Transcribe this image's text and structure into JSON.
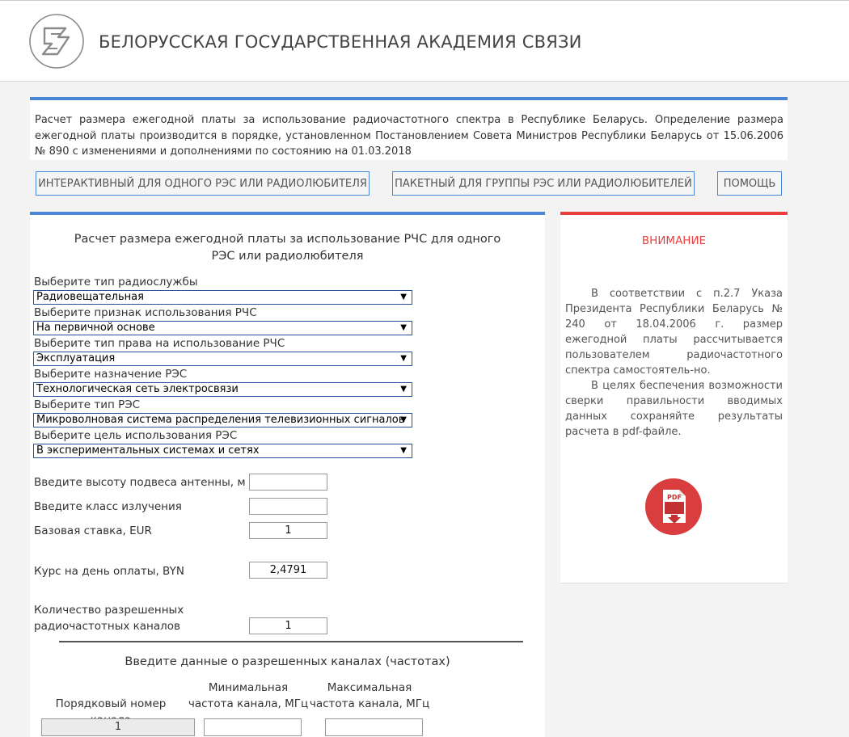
{
  "header": {
    "org_name": "БЕЛОРУССКАЯ ГОСУДАРСТВЕННАЯ АКАДЕМИЯ СВЯЗИ"
  },
  "notice": {
    "text": "Расчет размера ежегодной платы за использование радиочастотного спектра в Республике Беларусь. Определение размера ежегодной платы производится в порядке, установленном Постановлением Совета Министров Республики Беларусь от 15.06.2006 № 890 с изменениями и дополнениями по состоянию на 01.03.2018"
  },
  "tabs": {
    "interactive": "ИНТЕРАКТИВНЫЙ ДЛЯ ОДНОГО РЭС ИЛИ РАДИОЛЮБИТЕЛЯ",
    "batch": "ПАКЕТНЫЙ ДЛЯ ГРУППЫ РЭС ИЛИ РАДИОЛЮБИТЕЛЕЙ",
    "help": "ПОМОЩЬ"
  },
  "main": {
    "title": "Расчет размера ежегодной платы за использование РЧС для одного РЭС или радиолюбителя",
    "selects": [
      {
        "label": "Выберите тип радиослужбы",
        "value": "Радиовещательная"
      },
      {
        "label": "Выберите признак использования РЧС",
        "value": "На первичной основе"
      },
      {
        "label": "Выберите тип права на использование РЧС",
        "value": "Эксплуатация"
      },
      {
        "label": "Выберите назначение РЭС",
        "value": "Технологическая сеть электросвязи"
      },
      {
        "label": "Выберите тип РЭС",
        "value": "Микроволновая система распределения телевизионных сигналов"
      },
      {
        "label": "Выберите цель использования РЭС",
        "value": "В экспериментальных системах и сетях"
      }
    ],
    "antenna_height": {
      "label": "Введите высоту подвеса антенны, м",
      "value": ""
    },
    "emission_class": {
      "label": "Введите класс излучения",
      "value": ""
    },
    "base_rate": {
      "label": "Базовая ставка, EUR",
      "value": "1"
    },
    "exchange_rate": {
      "label": "Курс на день оплаты, BYN",
      "value": "2,4791"
    },
    "channel_count": {
      "label_line1": "Количество разрешенных",
      "label_line2": "радиочастотных каналов",
      "value": "1"
    },
    "channels": {
      "title": "Введите данные о разрешенных каналах (частотах)",
      "col_number": "Порядковый номер канала",
      "col_min_line1": "Минимальная",
      "col_min_line2": "частота канала, МГц",
      "col_max_line1": "Максимальная",
      "col_max_line2": "частота канала, МГц",
      "rows": [
        {
          "number": "1",
          "min": "",
          "max": ""
        }
      ]
    }
  },
  "side": {
    "title": "ВНИМАНИЕ",
    "para1": "В соответствии с п.2.7 Указа Президента Республики Беларусь № 240 от 18.04.2006 г. размер ежегодной платы рассчитывается пользователем радиочастотного спектра самостоятель-но.",
    "para2": "В целях беспечения возможности сверки правильности вводимых данных сохраняйте результаты расчета в pdf-файле.",
    "pdf_label": "PDF"
  },
  "colors": {
    "accent_blue": "#4a86d6",
    "accent_red": "#e84040",
    "select_border": "#2b4f9c"
  },
  "icons": {
    "logo": "academy-logo-icon",
    "pdf": "pdf-download-icon",
    "dropdown": "triangle-down-icon"
  }
}
